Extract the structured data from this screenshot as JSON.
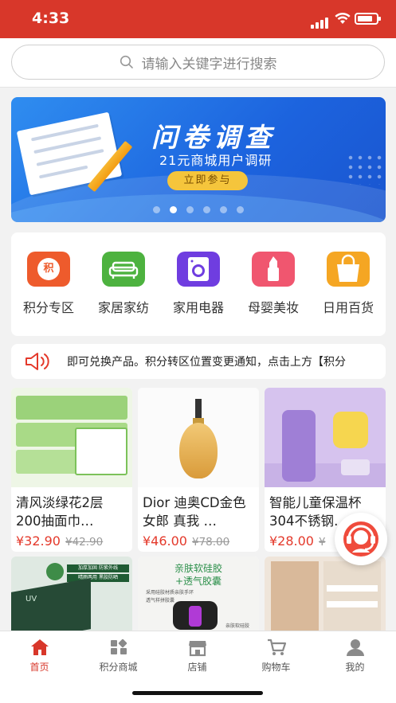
{
  "status_bar": {
    "time": "4:33"
  },
  "search": {
    "placeholder": "请输入关键字进行搜索"
  },
  "banner": {
    "title": "问卷调查",
    "subtitle": "21元商城用户调研",
    "cta": "立即参与",
    "slide_count": 6,
    "active_slide": 1
  },
  "categories": [
    {
      "label": "积分专区",
      "icon": "points-icon",
      "color": "#ee5b2c",
      "glyph": "积"
    },
    {
      "label": "家居家纺",
      "icon": "sofa-icon",
      "color": "#4db23f"
    },
    {
      "label": "家用电器",
      "icon": "washing-machine-icon",
      "color": "#6f3de0"
    },
    {
      "label": "母婴美妆",
      "icon": "lipstick-icon",
      "color": "#f0566f"
    },
    {
      "label": "日用百货",
      "icon": "shopping-bag-icon",
      "color": "#f5a623"
    }
  ],
  "notice": {
    "icon": "speaker-icon",
    "text": "即可兑换产品。积分转区位置变更通知，点击上方【积分"
  },
  "products": [
    {
      "name": "清风淡绿花2层200抽面巾…",
      "price": "¥32.90",
      "old_price": "¥42.90"
    },
    {
      "name": "Dior 迪奥CD金色女郎 真我 …",
      "price": "¥46.00",
      "old_price": "¥78.00"
    },
    {
      "name": "智能儿童保温杯304不锈钢…",
      "price": "¥28.00",
      "old_price": "¥"
    },
    {
      "name": "",
      "price": "",
      "old_price": "",
      "img_text": [
        "加厚加固 防紫外线",
        "晴雨两用 黑胶防晒",
        "UV"
      ]
    },
    {
      "name": "",
      "price": "",
      "old_price": "",
      "img_text": [
        "亲肤软硅胶",
        "+透气胶囊",
        "采用硅胶材质亲肤手环",
        "透气样拼胶囊",
        "亲肤软硅胶"
      ]
    },
    {
      "name": "",
      "price": "",
      "old_price": ""
    }
  ],
  "tabs": [
    {
      "label": "首页",
      "icon": "home-icon",
      "active": true
    },
    {
      "label": "积分商城",
      "icon": "points-mall-icon",
      "active": false
    },
    {
      "label": "店铺",
      "icon": "store-icon",
      "active": false
    },
    {
      "label": "购物车",
      "icon": "cart-icon",
      "active": false
    },
    {
      "label": "我的",
      "icon": "user-icon",
      "active": false
    }
  ],
  "colors": {
    "brand": "#d8372a",
    "price": "#e4392b"
  }
}
